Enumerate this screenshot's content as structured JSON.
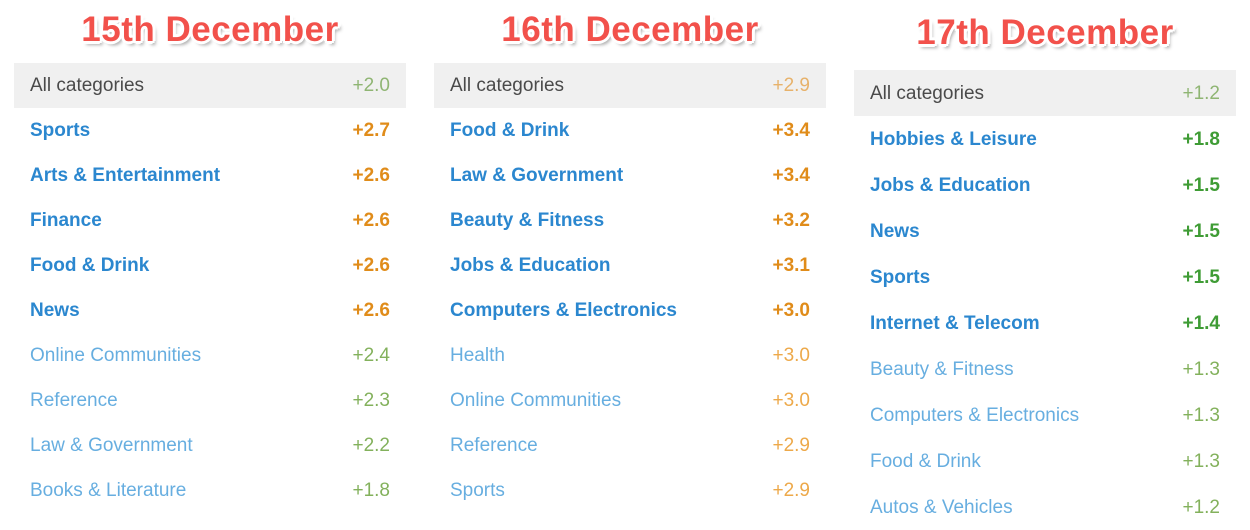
{
  "columns": [
    {
      "title": "15th December",
      "summary": {
        "label": "All categories",
        "value": "+2.0",
        "tone": "green-muted"
      },
      "rows": [
        {
          "label": "Sports",
          "value": "+2.7",
          "emphasis": "strong",
          "tone": "orange-strong"
        },
        {
          "label": "Arts & Entertainment",
          "value": "+2.6",
          "emphasis": "strong",
          "tone": "orange-strong"
        },
        {
          "label": "Finance",
          "value": "+2.6",
          "emphasis": "strong",
          "tone": "orange-strong"
        },
        {
          "label": "Food & Drink",
          "value": "+2.6",
          "emphasis": "strong",
          "tone": "orange-strong"
        },
        {
          "label": "News",
          "value": "+2.6",
          "emphasis": "strong",
          "tone": "orange-strong"
        },
        {
          "label": "Online Communities",
          "value": "+2.4",
          "emphasis": "light",
          "tone": "green-light"
        },
        {
          "label": "Reference",
          "value": "+2.3",
          "emphasis": "light",
          "tone": "green-light"
        },
        {
          "label": "Law & Government",
          "value": "+2.2",
          "emphasis": "light",
          "tone": "green-light"
        },
        {
          "label": "Books & Literature",
          "value": "+1.8",
          "emphasis": "light",
          "tone": "green-light"
        }
      ]
    },
    {
      "title": "16th December",
      "summary": {
        "label": "All categories",
        "value": "+2.9",
        "tone": "orange-muted"
      },
      "rows": [
        {
          "label": "Food & Drink",
          "value": "+3.4",
          "emphasis": "strong",
          "tone": "orange-strong"
        },
        {
          "label": "Law & Government",
          "value": "+3.4",
          "emphasis": "strong",
          "tone": "orange-strong"
        },
        {
          "label": "Beauty & Fitness",
          "value": "+3.2",
          "emphasis": "strong",
          "tone": "orange-strong"
        },
        {
          "label": "Jobs & Education",
          "value": "+3.1",
          "emphasis": "strong",
          "tone": "orange-strong"
        },
        {
          "label": "Computers & Electronics",
          "value": "+3.0",
          "emphasis": "strong",
          "tone": "orange-strong"
        },
        {
          "label": "Health",
          "value": "+3.0",
          "emphasis": "light",
          "tone": "orange-light"
        },
        {
          "label": "Online Communities",
          "value": "+3.0",
          "emphasis": "light",
          "tone": "orange-light"
        },
        {
          "label": "Reference",
          "value": "+2.9",
          "emphasis": "light",
          "tone": "orange-light"
        },
        {
          "label": "Sports",
          "value": "+2.9",
          "emphasis": "light",
          "tone": "orange-light"
        }
      ]
    },
    {
      "title": "17th December",
      "summary": {
        "label": "All categories",
        "value": "+1.2",
        "tone": "green-muted"
      },
      "rows": [
        {
          "label": "Hobbies & Leisure",
          "value": "+1.8",
          "emphasis": "strong",
          "tone": "green-strong"
        },
        {
          "label": "Jobs & Education",
          "value": "+1.5",
          "emphasis": "strong",
          "tone": "green-strong"
        },
        {
          "label": "News",
          "value": "+1.5",
          "emphasis": "strong",
          "tone": "green-strong"
        },
        {
          "label": "Sports",
          "value": "+1.5",
          "emphasis": "strong",
          "tone": "green-strong"
        },
        {
          "label": "Internet & Telecom",
          "value": "+1.4",
          "emphasis": "strong",
          "tone": "green-strong"
        },
        {
          "label": "Beauty & Fitness",
          "value": "+1.3",
          "emphasis": "light",
          "tone": "green-light"
        },
        {
          "label": "Computers & Electronics",
          "value": "+1.3",
          "emphasis": "light",
          "tone": "green-light"
        },
        {
          "label": "Food & Drink",
          "value": "+1.3",
          "emphasis": "light",
          "tone": "green-light"
        },
        {
          "label": "Autos & Vehicles",
          "value": "+1.2",
          "emphasis": "light",
          "tone": "green-light"
        }
      ]
    }
  ],
  "colors": {
    "title_red": "#f2514b",
    "label_blue_strong": "#2b87cf",
    "label_blue_light": "#67aee0",
    "summary_background": "#f0f0f0",
    "summary_label": "#4a4a4a",
    "green_strong": "#3f9c35",
    "green_light": "#83b15c",
    "green_muted": "#8fb573",
    "orange_strong": "#e08c1a",
    "orange_light": "#eda94a",
    "orange_muted": "#e7b26b"
  }
}
